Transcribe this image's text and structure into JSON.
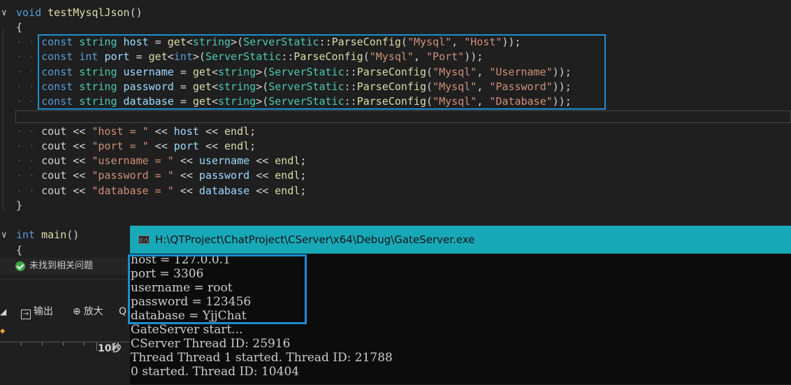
{
  "editor": {
    "lines": [
      {
        "segments": [
          [
            "kw",
            "void "
          ],
          [
            "fn",
            "testMysqlJson"
          ],
          [
            "pl",
            "()"
          ]
        ],
        "fold": "v"
      },
      {
        "segments": [
          [
            "pl",
            "{"
          ]
        ]
      },
      {
        "segments": [
          [
            "dots",
            "· · "
          ],
          [
            "kw",
            "const "
          ],
          [
            "ty",
            "string "
          ],
          [
            "var",
            "host "
          ],
          [
            "op",
            "= "
          ],
          [
            "fn",
            "get"
          ],
          [
            "pl",
            "<"
          ],
          [
            "ty",
            "string"
          ],
          [
            "pl",
            ">("
          ],
          [
            "ty",
            "ServerStatic"
          ],
          [
            "pl",
            "::"
          ],
          [
            "fn",
            "ParseConfig"
          ],
          [
            "pl",
            "("
          ],
          [
            "str",
            "\"Mysql\""
          ],
          [
            "pl",
            ", "
          ],
          [
            "str",
            "\"Host\""
          ],
          [
            "pl",
            "));"
          ]
        ]
      },
      {
        "segments": [
          [
            "dots",
            "· · "
          ],
          [
            "kw",
            "const "
          ],
          [
            "kw",
            "int "
          ],
          [
            "var",
            "port "
          ],
          [
            "op",
            "= "
          ],
          [
            "fn",
            "get"
          ],
          [
            "pl",
            "<"
          ],
          [
            "kw",
            "int"
          ],
          [
            "pl",
            ">("
          ],
          [
            "ty",
            "ServerStatic"
          ],
          [
            "pl",
            "::"
          ],
          [
            "fn",
            "ParseConfig"
          ],
          [
            "pl",
            "("
          ],
          [
            "str",
            "\"Mysql\""
          ],
          [
            "pl",
            ", "
          ],
          [
            "str",
            "\"Port\""
          ],
          [
            "pl",
            "));"
          ]
        ]
      },
      {
        "segments": [
          [
            "dots",
            "· · "
          ],
          [
            "kw",
            "const "
          ],
          [
            "ty",
            "string "
          ],
          [
            "var",
            "username "
          ],
          [
            "op",
            "= "
          ],
          [
            "fn",
            "get"
          ],
          [
            "pl",
            "<"
          ],
          [
            "ty",
            "string"
          ],
          [
            "pl",
            ">("
          ],
          [
            "ty",
            "ServerStatic"
          ],
          [
            "pl",
            "::"
          ],
          [
            "fn",
            "ParseConfig"
          ],
          [
            "pl",
            "("
          ],
          [
            "str",
            "\"Mysql\""
          ],
          [
            "pl",
            ", "
          ],
          [
            "str",
            "\"Username\""
          ],
          [
            "pl",
            "));"
          ]
        ]
      },
      {
        "segments": [
          [
            "dots",
            "· · "
          ],
          [
            "kw",
            "const "
          ],
          [
            "ty",
            "string "
          ],
          [
            "var",
            "password "
          ],
          [
            "op",
            "= "
          ],
          [
            "fn",
            "get"
          ],
          [
            "pl",
            "<"
          ],
          [
            "ty",
            "string"
          ],
          [
            "pl",
            ">("
          ],
          [
            "ty",
            "ServerStatic"
          ],
          [
            "pl",
            "::"
          ],
          [
            "fn",
            "ParseConfig"
          ],
          [
            "pl",
            "("
          ],
          [
            "str",
            "\"Mysql\""
          ],
          [
            "pl",
            ", "
          ],
          [
            "str",
            "\"Password\""
          ],
          [
            "pl",
            "));"
          ]
        ]
      },
      {
        "segments": [
          [
            "dots",
            "· · "
          ],
          [
            "kw",
            "const "
          ],
          [
            "ty",
            "string "
          ],
          [
            "var",
            "database "
          ],
          [
            "op",
            "= "
          ],
          [
            "fn",
            "get"
          ],
          [
            "pl",
            "<"
          ],
          [
            "ty",
            "string"
          ],
          [
            "pl",
            ">("
          ],
          [
            "ty",
            "ServerStatic"
          ],
          [
            "pl",
            "::"
          ],
          [
            "fn",
            "ParseConfig"
          ],
          [
            "pl",
            "("
          ],
          [
            "str",
            "\"Mysql\""
          ],
          [
            "pl",
            ", "
          ],
          [
            "str",
            "\"Database\""
          ],
          [
            "pl",
            "));"
          ]
        ]
      },
      {
        "segments": []
      },
      {
        "segments": [
          [
            "dots",
            "· · "
          ],
          [
            "pl",
            "cout "
          ],
          [
            "op",
            "<< "
          ],
          [
            "str",
            "\"host = \" "
          ],
          [
            "op",
            "<< "
          ],
          [
            "var",
            "host "
          ],
          [
            "op",
            "<< "
          ],
          [
            "fn",
            "endl"
          ],
          [
            "pl",
            ";"
          ]
        ]
      },
      {
        "segments": [
          [
            "dots",
            "· · "
          ],
          [
            "pl",
            "cout "
          ],
          [
            "op",
            "<< "
          ],
          [
            "str",
            "\"port = \" "
          ],
          [
            "op",
            "<< "
          ],
          [
            "var",
            "port "
          ],
          [
            "op",
            "<< "
          ],
          [
            "fn",
            "endl"
          ],
          [
            "pl",
            ";"
          ]
        ]
      },
      {
        "segments": [
          [
            "dots",
            "· · "
          ],
          [
            "pl",
            "cout "
          ],
          [
            "op",
            "<< "
          ],
          [
            "str",
            "\"username = \" "
          ],
          [
            "op",
            "<< "
          ],
          [
            "var",
            "username "
          ],
          [
            "op",
            "<< "
          ],
          [
            "fn",
            "endl"
          ],
          [
            "pl",
            ";"
          ]
        ]
      },
      {
        "segments": [
          [
            "dots",
            "· · "
          ],
          [
            "pl",
            "cout "
          ],
          [
            "op",
            "<< "
          ],
          [
            "str",
            "\"password = \" "
          ],
          [
            "op",
            "<< "
          ],
          [
            "var",
            "password "
          ],
          [
            "op",
            "<< "
          ],
          [
            "fn",
            "endl"
          ],
          [
            "pl",
            ";"
          ]
        ]
      },
      {
        "segments": [
          [
            "dots",
            "· · "
          ],
          [
            "pl",
            "cout "
          ],
          [
            "op",
            "<< "
          ],
          [
            "str",
            "\"database = \" "
          ],
          [
            "op",
            "<< "
          ],
          [
            "var",
            "database "
          ],
          [
            "op",
            "<< "
          ],
          [
            "fn",
            "endl"
          ],
          [
            "pl",
            ";"
          ]
        ]
      },
      {
        "segments": [
          [
            "pl",
            "}"
          ]
        ]
      },
      {
        "segments": []
      },
      {
        "segments": [
          [
            "kw",
            "int "
          ],
          [
            "fn",
            "main"
          ],
          [
            "pl",
            "()"
          ]
        ],
        "fold": "v"
      },
      {
        "segments": [
          [
            "pl",
            "{"
          ]
        ]
      }
    ]
  },
  "issues": {
    "label": "未找到相关问题"
  },
  "toolbar": {
    "output_label": "输出",
    "zoom_label": "放大",
    "zoom_more": "Q"
  },
  "ruler": {
    "label": "10秒"
  },
  "console": {
    "title": "H:\\QTProject\\ChatProject\\CServer\\x64\\Debug\\GateServer.exe",
    "lines": [
      "host = 127.0.0.1",
      "port = 3306",
      "username = root",
      "password = 123456",
      "database = YjjChat",
      "GateServer start...",
      "CServer Thread ID: 25916",
      "Thread Thread 1 started. Thread ID: 21788",
      "0 started. Thread ID: 10404"
    ]
  }
}
